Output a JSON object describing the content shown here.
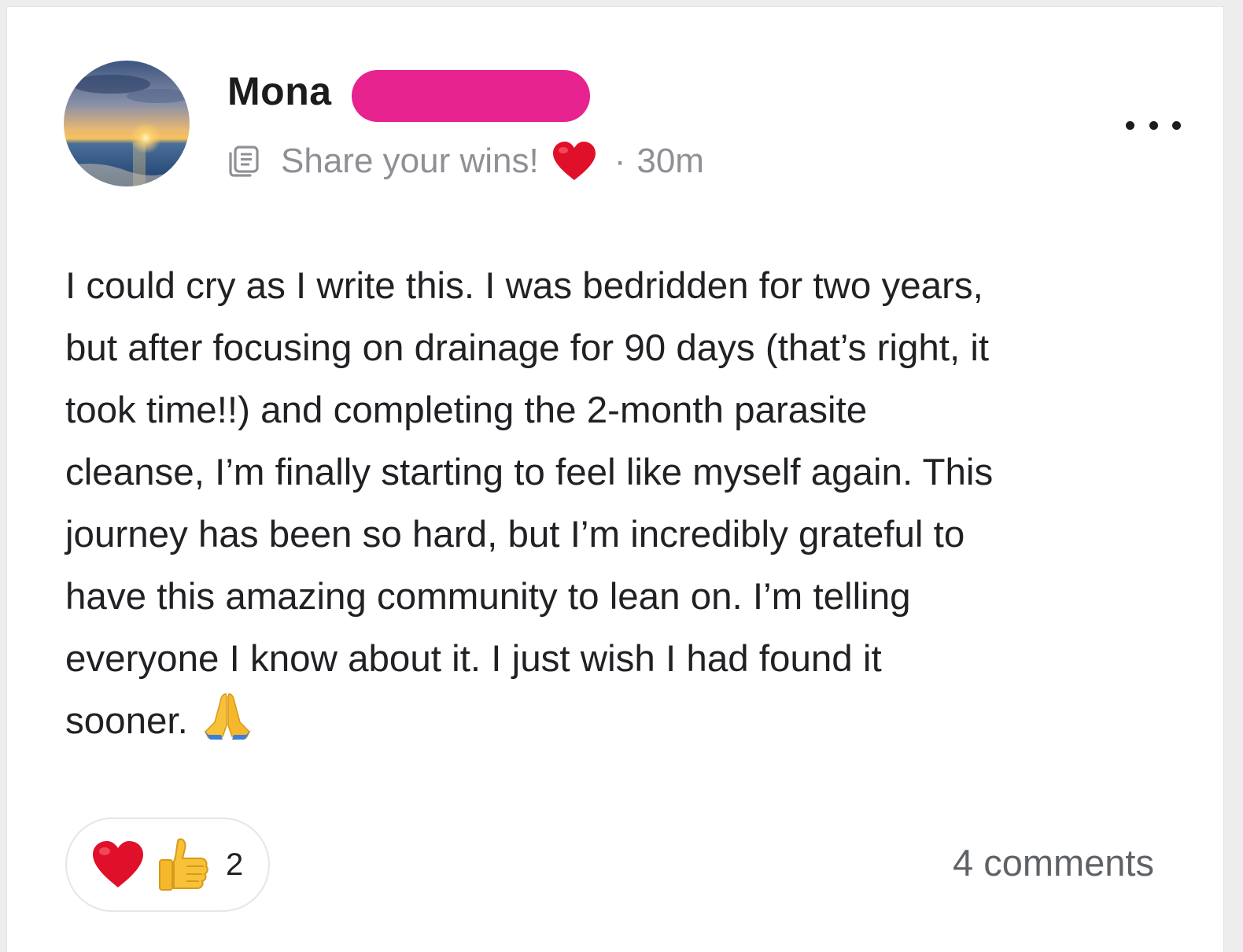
{
  "post": {
    "author_name": "Mona",
    "space_name": "Share your wins!",
    "separator": "·",
    "time_ago": "30m",
    "body_lines": [
      "I could cry as I write this. I was bedridden for two years,",
      "but after focusing on drainage for 90 days (that’s right, it",
      "took time!!) and completing the 2-month parasite",
      "cleanse, I’m finally starting to feel like myself again. This",
      "journey has been so hard, but I’m incredibly grateful to",
      "have this amazing community to lean on. I’m telling",
      "everyone I know about it. I just wish I had found it",
      "sooner."
    ],
    "reactions": {
      "icons": [
        "heart-icon",
        "thumbs-up-icon"
      ],
      "count": "2"
    },
    "comments_label": "4 comments"
  },
  "icons": {
    "space": "document-icon",
    "space_emoji": "heart-icon",
    "body_emoji": "folded-hands-icon",
    "menu": "more-options-icon"
  },
  "colors": {
    "redaction": "#e6238f",
    "heart": "#e0102a",
    "muted_text": "#8e9095",
    "body_text": "#202124"
  }
}
